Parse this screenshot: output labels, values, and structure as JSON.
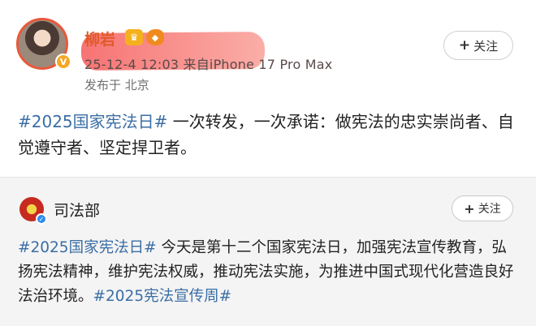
{
  "post": {
    "username": "柳岩",
    "meta": "25-12-4 12:03 来自iPhone 17 Pro Max",
    "location": "发布于 北京",
    "follow_label": "关注",
    "tag": "#2025国家宪法日#",
    "text": " 一次转发，一次承诺：做宪法的忠实崇尚者、自觉遵守者、坚定捍卫者。"
  },
  "repost": {
    "org_name": "司法部",
    "follow_label": "关注",
    "tag1": "#2025国家宪法日#",
    "text": " 今天是第十二个国家宪法日，加强宪法宣传教育，弘扬宪法精神，维护宪法权威，推动宪法实施，为推进中国式现代化营造良好法治环境。",
    "tag2": "#2025宪法宣传周#"
  }
}
